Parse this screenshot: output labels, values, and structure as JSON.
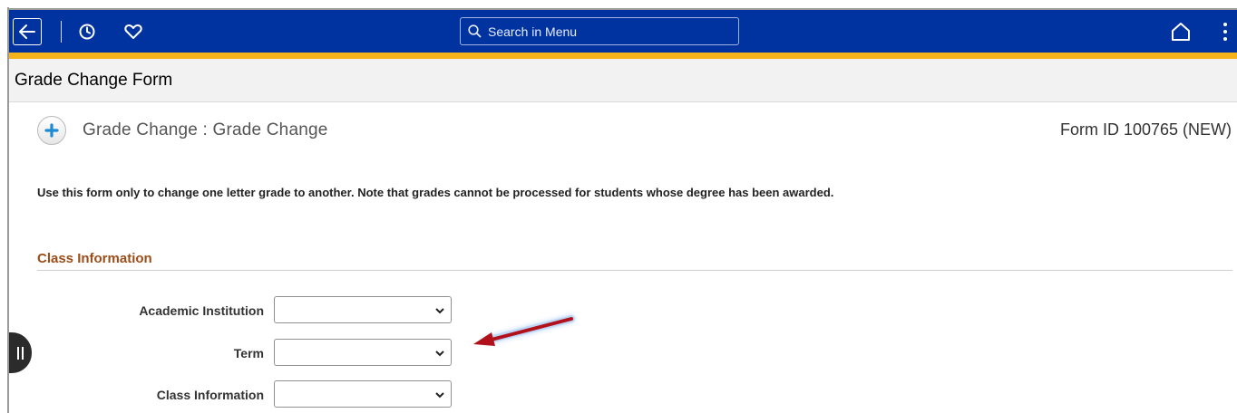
{
  "header": {
    "search_placeholder": "Search in Menu",
    "icons": [
      "back-arrow-icon",
      "history-clock-icon",
      "heart-favorites-icon",
      "search-icon",
      "home-icon",
      "more-vertical-icon"
    ],
    "colors": {
      "bar": "#0033a0",
      "accent_stripe": "#f7b31b"
    }
  },
  "page": {
    "title": "Grade Change Form",
    "section_heading": "Grade Change : Grade Change",
    "form_id": "Form ID 100765 (NEW)",
    "instruction": "Use this form only to change one letter grade to another.  Note that grades cannot be processed for students whose degree has been awarded."
  },
  "class_info": {
    "heading": "Class Information",
    "fields": [
      {
        "label": "Academic Institution",
        "value": ""
      },
      {
        "label": "Term",
        "value": ""
      },
      {
        "label": "Class Information",
        "value": ""
      }
    ]
  },
  "annotation": {
    "type": "red-arrow",
    "points_to": "Term"
  }
}
